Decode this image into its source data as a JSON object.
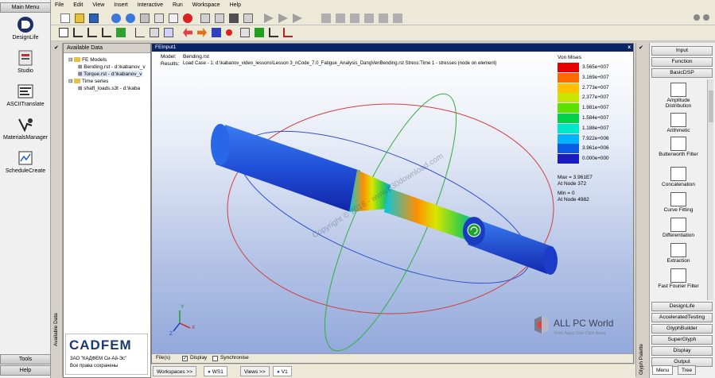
{
  "main_menu": {
    "header": "Main Menu",
    "items": [
      "DesignLife",
      "Studio",
      "ASCIITranslate",
      "MaterialsManager",
      "ScheduleCreate"
    ],
    "tools": "Tools",
    "help": "Help"
  },
  "menubar": [
    "File",
    "Edit",
    "View",
    "Insert",
    "Interactive",
    "Run",
    "Workspace",
    "Help"
  ],
  "available_data": {
    "title": "Available Data",
    "vertical_label": "Available Data",
    "tree": [
      {
        "label": "FE Models",
        "level": 1
      },
      {
        "label": "Bending.rst - d:\\kabanov_v",
        "level": 2
      },
      {
        "label": "Torque.rst - d:\\kabanov_v",
        "level": 2
      },
      {
        "label": "Time series",
        "level": 1
      },
      {
        "label": "shaft_loads.s3t - d:\\kaba",
        "level": 2
      }
    ]
  },
  "viewport": {
    "title": "FEInput1",
    "close": "x",
    "model_label": "Model:",
    "model_value": "Bending.rst",
    "results_label": "Results:",
    "results_value": "Load Case - 1: d:\\kabanov_video_lessons\\Lesson 3_nCode_7.0_Fatigue_Analysis_DangVenBending.rst Stress:Time 1 - stresses (node on element)",
    "legend_title": "Von Mises",
    "legend": [
      {
        "label": "3.565e+007",
        "color": "#e60000"
      },
      {
        "label": "3.169e+007",
        "color": "#ff6a00"
      },
      {
        "label": "2.773e+007",
        "color": "#ffc000"
      },
      {
        "label": "2.377e+007",
        "color": "#c8e600"
      },
      {
        "label": "1.981e+007",
        "color": "#5ee000"
      },
      {
        "label": "1.584e+007",
        "color": "#00d24a"
      },
      {
        "label": "1.188e+007",
        "color": "#00e6c8"
      },
      {
        "label": "7.922e+006",
        "color": "#00b4ff"
      },
      {
        "label": "3.961e+006",
        "color": "#0a5ae6"
      },
      {
        "label": "0.000e+000",
        "color": "#1b1bc4"
      }
    ],
    "max_line1": "Max = 3.961E7",
    "max_line2": "At Node 372",
    "min_line1": "Min = 0",
    "min_line2": "At Node 4982",
    "watermark": "Copyright © 2018 - www.p30download.com",
    "axis_x": "X",
    "axis_y": "Y",
    "axis_z": "Z"
  },
  "files_bar": {
    "files": "File(s)",
    "display": "Display",
    "synchronise": "Synchronise"
  },
  "bottom_tabs": {
    "workspaces": "Workspaces >>",
    "ws1": "WS1",
    "views": "Views >>",
    "v1": "V1"
  },
  "palette": {
    "headers_top": [
      "Input",
      "Function",
      "BasicDSP"
    ],
    "glyphs": [
      "Amplitude Distribution",
      "Arithmetic",
      "Butterworth Filter",
      "Concatenation",
      "Curve Fitting",
      "Differentiation",
      "Extraction",
      "Fast Fourier Filter"
    ],
    "headers_bottom": [
      "DesignLife",
      "AcceleratedTesting",
      "GlyphBuilder",
      "SuperGlyph",
      "Display",
      "Output"
    ],
    "vertical_label": "Glyph Palette",
    "tab_menu": "Menu",
    "tab_tree": "Tree"
  },
  "cadfem": {
    "logo": "CADFEM",
    "line1": "ЗАО \"КАДФЕМ Си-Ай-Эс\"",
    "line2": "Все права сохранены"
  },
  "allpc": {
    "name": "ALL PC World",
    "tagline": "Free Apps One Click Away"
  },
  "colors": {
    "titlebar": "#0a246a",
    "viewport_bg_top": "#ffffff",
    "viewport_bg_bottom": "#93a9dc"
  }
}
